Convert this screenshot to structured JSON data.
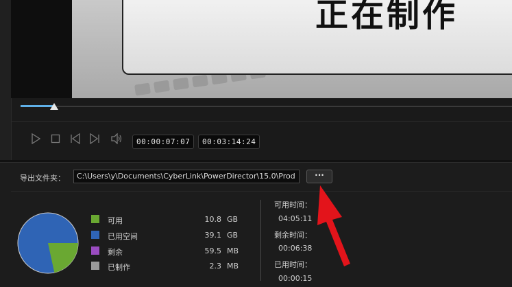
{
  "preview": {
    "title_text": "正在制作"
  },
  "transport": {
    "current_time": "00:00:07:07",
    "total_time": "00:03:14:24"
  },
  "export": {
    "label": "导出文件夹：",
    "path": "C:\\Users\\y\\Documents\\CyberLink\\PowerDirector\\15.0\\Prod",
    "browse_label": "···"
  },
  "disk": {
    "legend": [
      {
        "label": "可用",
        "value": "10.8",
        "unit": "GB",
        "color": "#6aa832"
      },
      {
        "label": "已用空间",
        "value": "39.1",
        "unit": "GB",
        "color": "#2f64b5"
      },
      {
        "label": "剩余",
        "value": "59.5",
        "unit": "MB",
        "color": "#9a4cc0"
      },
      {
        "label": "已制作",
        "value": "2.3",
        "unit": "MB",
        "color": "#9a9a9a"
      }
    ],
    "pie_fractions": {
      "available": 0.216,
      "used": 0.784
    }
  },
  "time_info": {
    "available_label": "可用时间：",
    "available_value": "04:05:11",
    "remaining_label": "剩余时间：",
    "remaining_value": "00:06:38",
    "produced_label": "已用时间：",
    "produced_value": "00:00:15"
  },
  "colors": {
    "accent": "#5fb0e8",
    "arrow": "#e3141b"
  }
}
